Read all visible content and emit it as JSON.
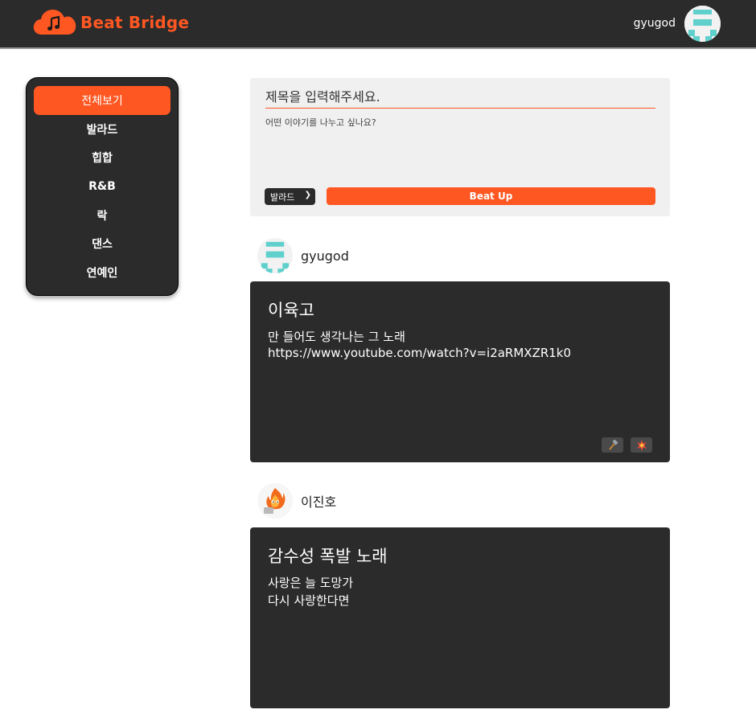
{
  "header": {
    "brand": "Beat Bridge",
    "username": "gyugod"
  },
  "sidebar": {
    "items": [
      {
        "label": "전체보기",
        "active": true
      },
      {
        "label": "발라드"
      },
      {
        "label": "힙합"
      },
      {
        "label": "R&B"
      },
      {
        "label": "락"
      },
      {
        "label": "댄스"
      },
      {
        "label": "연예인"
      }
    ]
  },
  "composer": {
    "title_placeholder": "제목을 입력해주세요.",
    "body_placeholder": "어떤 이야기를 나누고 싶나요?",
    "genre_selected": "발라드",
    "submit_label": "Beat Up"
  },
  "posts": [
    {
      "author": "gyugod",
      "title": "이육고",
      "lines": [
        "만 들어도 생각나는 그 노래",
        "https://www.youtube.com/watch?v=i2aRMXZR1k0"
      ],
      "actions": [
        "hammer-icon",
        "collision-icon"
      ]
    },
    {
      "author": "이진호",
      "title": "감수성 폭발 노래",
      "lines": [
        "사랑은 늘 도망가",
        "다시 사랑한다면"
      ]
    }
  ],
  "colors": {
    "accent": "#ff5722",
    "dark": "#2b2b2b",
    "composer_bg": "#f0f0f0"
  }
}
